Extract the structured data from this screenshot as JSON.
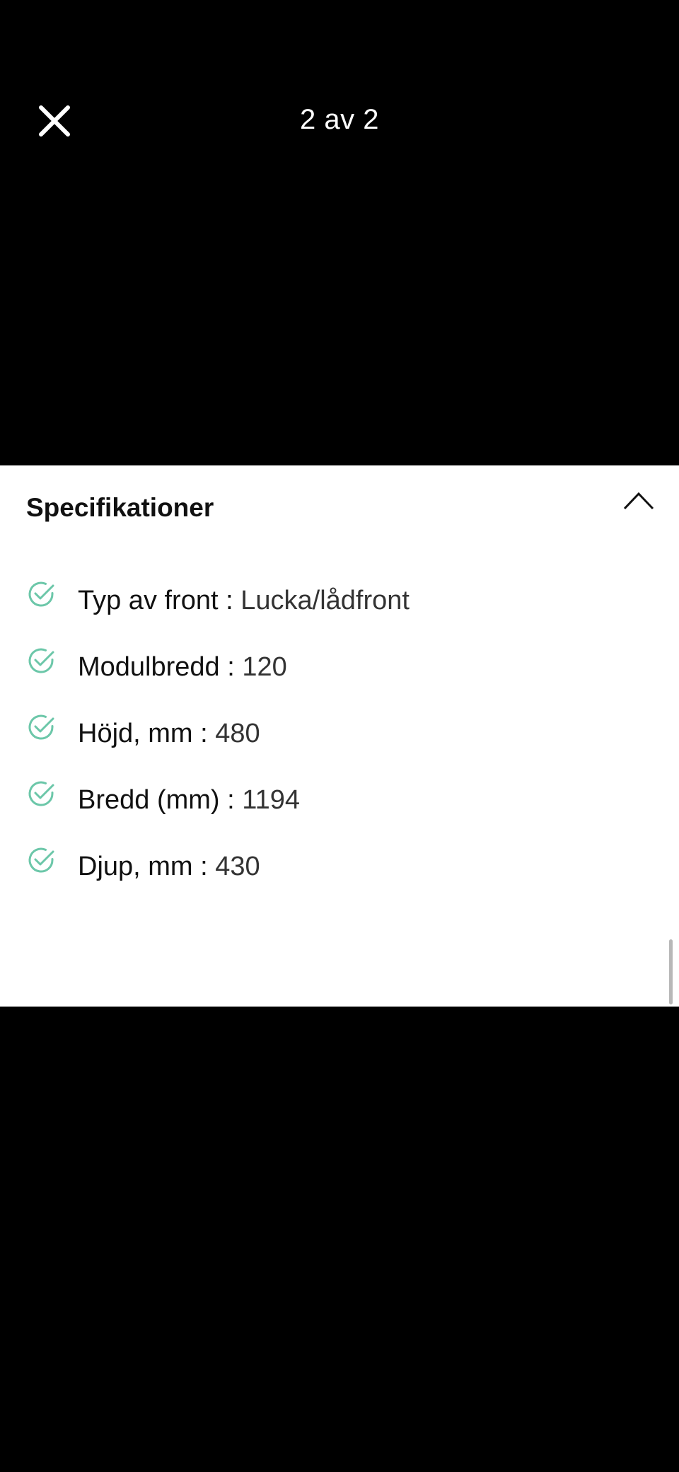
{
  "viewer": {
    "counter": "2 av 2"
  },
  "specifications": {
    "title": "Specifikationer",
    "items": [
      {
        "label": "Typ av front",
        "value": "Lucka/lådfront"
      },
      {
        "label": "Modulbredd",
        "value": "120"
      },
      {
        "label": "Höjd, mm",
        "value": "480"
      },
      {
        "label": "Bredd (mm)",
        "value": "1194"
      },
      {
        "label": "Djup, mm",
        "value": "430"
      }
    ],
    "separator": " : "
  },
  "icons": {
    "close": "close-icon",
    "collapse": "chevron-up-icon",
    "check": "check-circle-icon"
  },
  "colors": {
    "background": "#000000",
    "card": "#ffffff",
    "check_accent": "#6cc7a9",
    "text": "#111111"
  }
}
